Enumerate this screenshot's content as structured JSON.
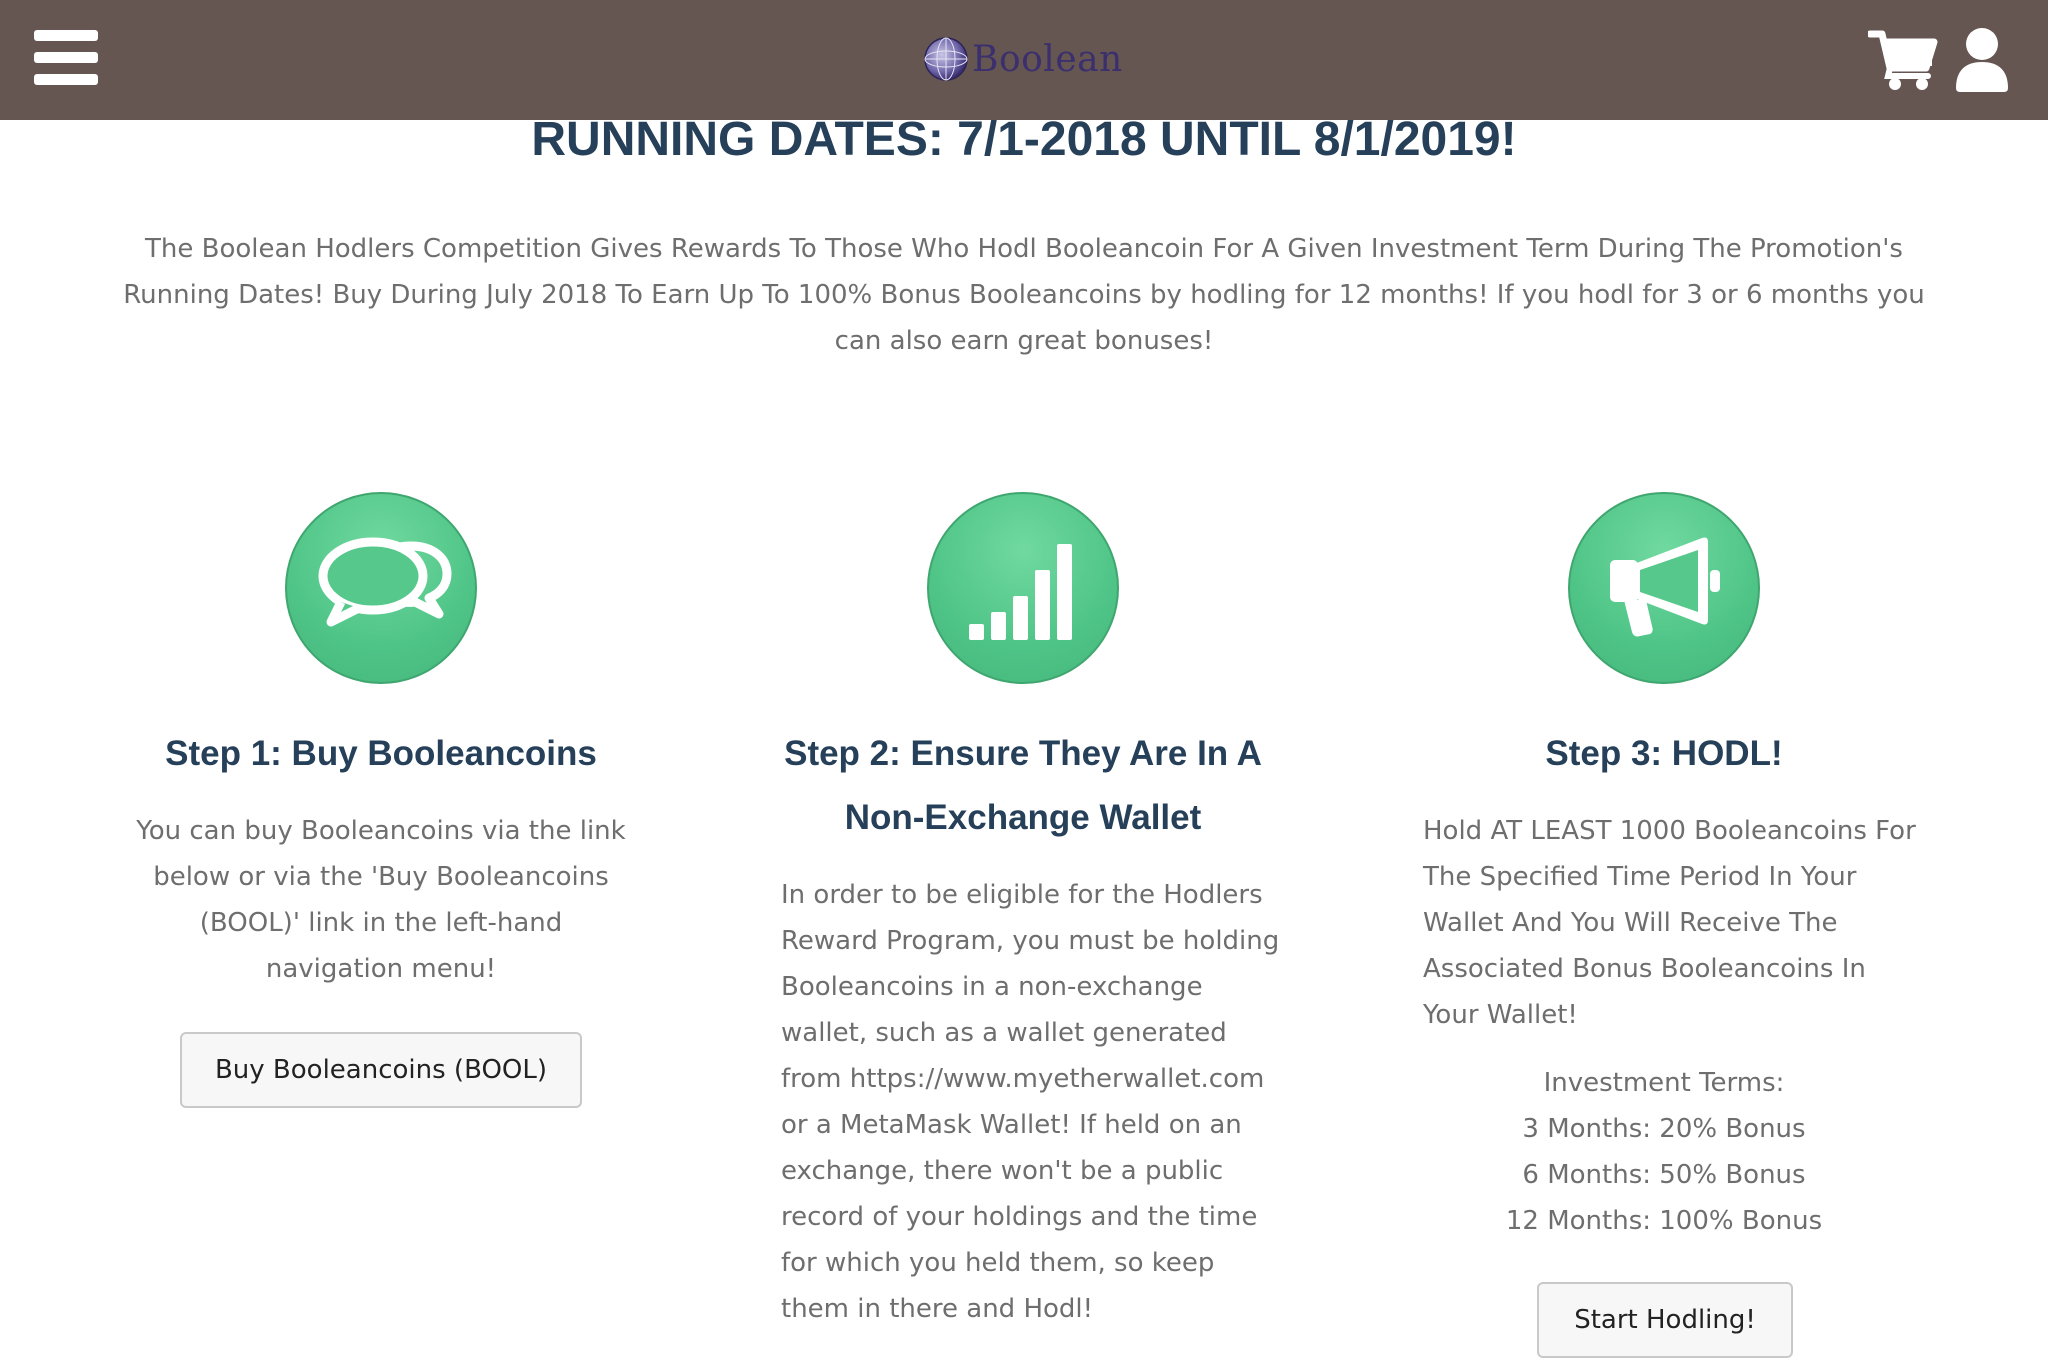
{
  "header": {
    "logo_text": "Boolean",
    "menu_icon": "hamburger-menu-icon",
    "cart_icon": "shopping-cart-icon",
    "user_icon": "user-account-icon",
    "background_color": "#655652"
  },
  "headline": "RUNNING DATES: 7/1-2018 UNTIL 8/1/2019!",
  "intro": "The Boolean Hodlers Competition Gives Rewards To Those Who Hodl Booleancoin For A Given Investment Term During The Promotion's Running Dates! Buy During July 2018 To Earn Up To 100% Bonus Booleancoins by hodling for 12 months! If you hodl for 3 or 6 months you can also earn great bonuses!",
  "steps": [
    {
      "icon": "chat-bubbles-icon",
      "title": "Step 1: Buy Booleancoins",
      "body": "You can buy Booleancoins via the link below or via the 'Buy Booleancoins (BOOL)' link in the left-hand navigation menu!",
      "button_label": "Buy Booleancoins (BOOL)"
    },
    {
      "icon": "signal-bars-icon",
      "title": "Step 2: Ensure They Are In A Non-Exchange Wallet",
      "body": "In order to be eligible for the Hodlers Reward Program, you must be holding Booleancoins in a non-exchange wallet, such as a wallet generated from https://www.myetherwallet.com or a MetaMask Wallet!  If held on an exchange, there won't be a public record of your holdings and the time for which you held them, so keep them in there and Hodl!"
    },
    {
      "icon": "megaphone-icon",
      "title": "Step 3: HODL!",
      "body": "Hold AT LEAST 1000 Booleancoins For The Specified Time Period In Your Wallet And You Will Receive The Associated Bonus Booleancoins In Your Wallet!",
      "terms": {
        "heading": "Investment Terms:",
        "items": [
          "3 Months: 20% Bonus",
          "6 Months: 50% Bonus",
          "12 Months: 100% Bonus"
        ]
      },
      "button_label": "Start Hodling!"
    }
  ],
  "colors": {
    "heading": "#26405a",
    "body_text": "#6e6e6e",
    "icon_circle": "#4fc487"
  }
}
